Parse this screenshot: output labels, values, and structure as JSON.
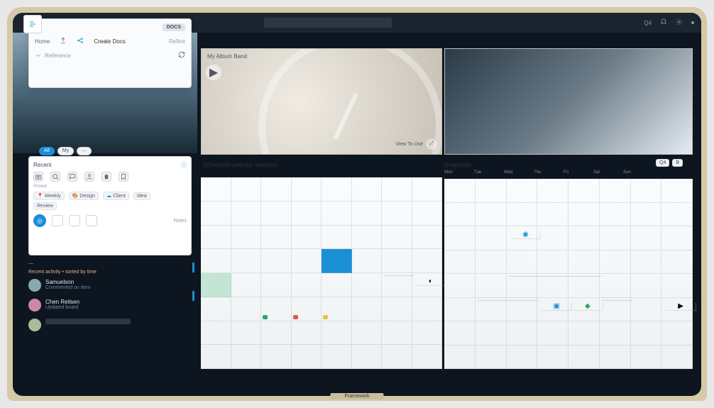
{
  "topbar": {
    "items": [
      "Q4",
      "",
      "",
      ""
    ]
  },
  "floater": {
    "badge": "DOCS",
    "tab_home": "Home",
    "tab_create": "Create Docs",
    "tab_label": "Refine",
    "sub": "Reference"
  },
  "hero": {
    "overlay_title": "My Album Band",
    "corner_label": "View To Use"
  },
  "sections": {
    "calendar_title": "Scheduled calendar selection",
    "board_title": "Snapshots",
    "chip_a": "Q4",
    "chip_b": "B",
    "head": [
      "Mon",
      "Tue",
      "Wed",
      "Thu",
      "Fri",
      "Sat",
      "Sun",
      "—"
    ]
  },
  "side2": {
    "title": "Recent",
    "pill_a": "All",
    "pill_b": "My",
    "small": "Pinned",
    "chip1": "Weekly",
    "chip2": "Design",
    "chip3": "Client",
    "chip4": "Idea",
    "chip5": "Review",
    "foot": "Notes"
  },
  "feed": {
    "meta": "Recent activity • sorted by time",
    "i1_name": "Samuelson",
    "i1_sub": "Commented on item",
    "i2_name": "Chen Reilsen",
    "i2_sub": "Updated board"
  },
  "bottom_brand": "Framework"
}
